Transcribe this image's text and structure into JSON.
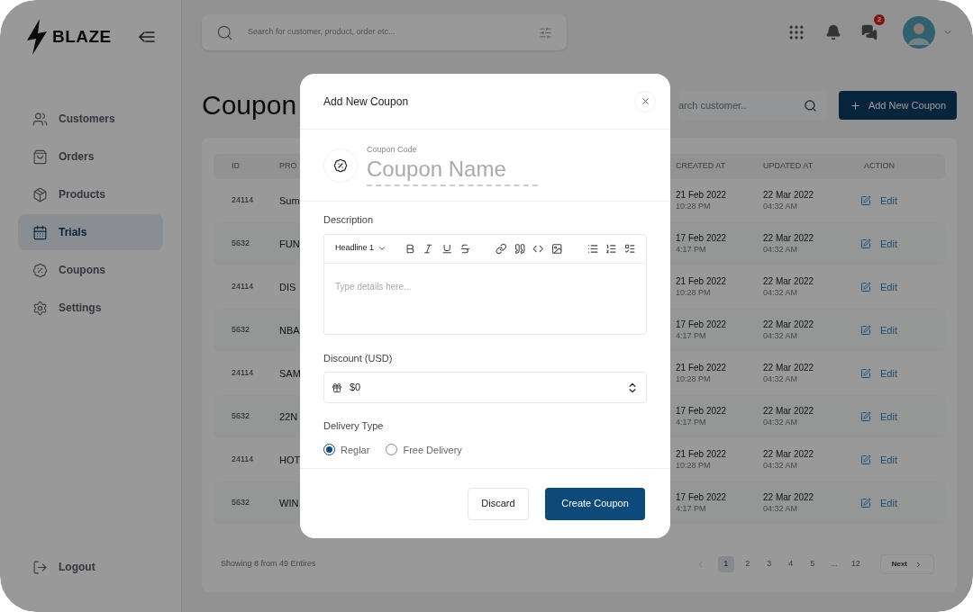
{
  "brand": {
    "name": "BLAZE"
  },
  "sidebar": {
    "items": [
      {
        "label": "Customers",
        "selected": false
      },
      {
        "label": "Orders",
        "selected": false
      },
      {
        "label": "Products",
        "selected": false
      },
      {
        "label": "Trials",
        "selected": true
      },
      {
        "label": "Coupons",
        "selected": false
      },
      {
        "label": "Settings",
        "selected": false
      }
    ],
    "logout": "Logout"
  },
  "topbar": {
    "search_placeholder": "Search for customer, product, order etc...",
    "messages_badge": "2"
  },
  "page": {
    "title": "Coupon",
    "search_value": "arch customer..",
    "add_button": "Add New Coupon"
  },
  "table": {
    "columns": [
      "ID",
      "PRO",
      "CREATED AT",
      "UPDATED AT",
      "ACTION"
    ],
    "rows": [
      {
        "id": "24114",
        "promo": "Sum",
        "created_date": "21 Feb 2022",
        "created_time": "10:28 PM",
        "updated_date": "22 Mar 2022",
        "updated_time": "04:32 AM",
        "action": "Edit"
      },
      {
        "id": "5632",
        "promo": "FUN",
        "created_date": "17 Feb 2022",
        "created_time": "4:17 PM",
        "updated_date": "22 Mar 2022",
        "updated_time": "04:32 AM",
        "action": "Edit"
      },
      {
        "id": "24114",
        "promo": "DIS",
        "created_date": "21 Feb 2022",
        "created_time": "10:28 PM",
        "updated_date": "22 Mar 2022",
        "updated_time": "04:32 AM",
        "action": "Edit"
      },
      {
        "id": "5632",
        "promo": "NBA",
        "created_date": "17 Feb 2022",
        "created_time": "4:17 PM",
        "updated_date": "22 Mar 2022",
        "updated_time": "04:32 AM",
        "action": "Edit"
      },
      {
        "id": "24114",
        "promo": "SAM",
        "created_date": "21 Feb 2022",
        "created_time": "10:28 PM",
        "updated_date": "22 Mar 2022",
        "updated_time": "04:32 AM",
        "action": "Edit"
      },
      {
        "id": "5632",
        "promo": "22N",
        "created_date": "17 Feb 2022",
        "created_time": "4:17 PM",
        "updated_date": "22 Mar 2022",
        "updated_time": "04:32 AM",
        "action": "Edit"
      },
      {
        "id": "24114",
        "promo": "HOT",
        "created_date": "21 Feb 2022",
        "created_time": "10:28 PM",
        "updated_date": "22 Mar 2022",
        "updated_time": "04:32 AM",
        "action": "Edit"
      },
      {
        "id": "5632",
        "promo": "WIN",
        "created_date": "17 Feb 2022",
        "created_time": "4:17 PM",
        "updated_date": "22 Mar 2022",
        "updated_time": "04:32 AM",
        "action": "Edit"
      }
    ],
    "footer": "Showing 8 from 49 Entires",
    "pages": [
      {
        "label": "1",
        "selected": true
      },
      {
        "label": "2",
        "selected": false
      },
      {
        "label": "3",
        "selected": false
      },
      {
        "label": "4",
        "selected": false
      },
      {
        "label": "5",
        "selected": false
      },
      {
        "label": "...",
        "selected": false
      },
      {
        "label": "12",
        "selected": false
      }
    ],
    "next": "Next"
  },
  "modal": {
    "title": "Add New Coupon",
    "code_label": "Coupon Code",
    "name_placeholder": "Coupon Name",
    "description": {
      "label": "Description",
      "heading_style": "Headline 1",
      "placeholder": "Type details here..."
    },
    "discount": {
      "label": "Discount (USD)",
      "value": "$0"
    },
    "delivery": {
      "label": "Delivery Type",
      "options": [
        {
          "label": "Reglar",
          "selected": true
        },
        {
          "label": "Free Delivery",
          "selected": false
        }
      ]
    },
    "discard": "Discard",
    "create": "Create Coupon"
  }
}
